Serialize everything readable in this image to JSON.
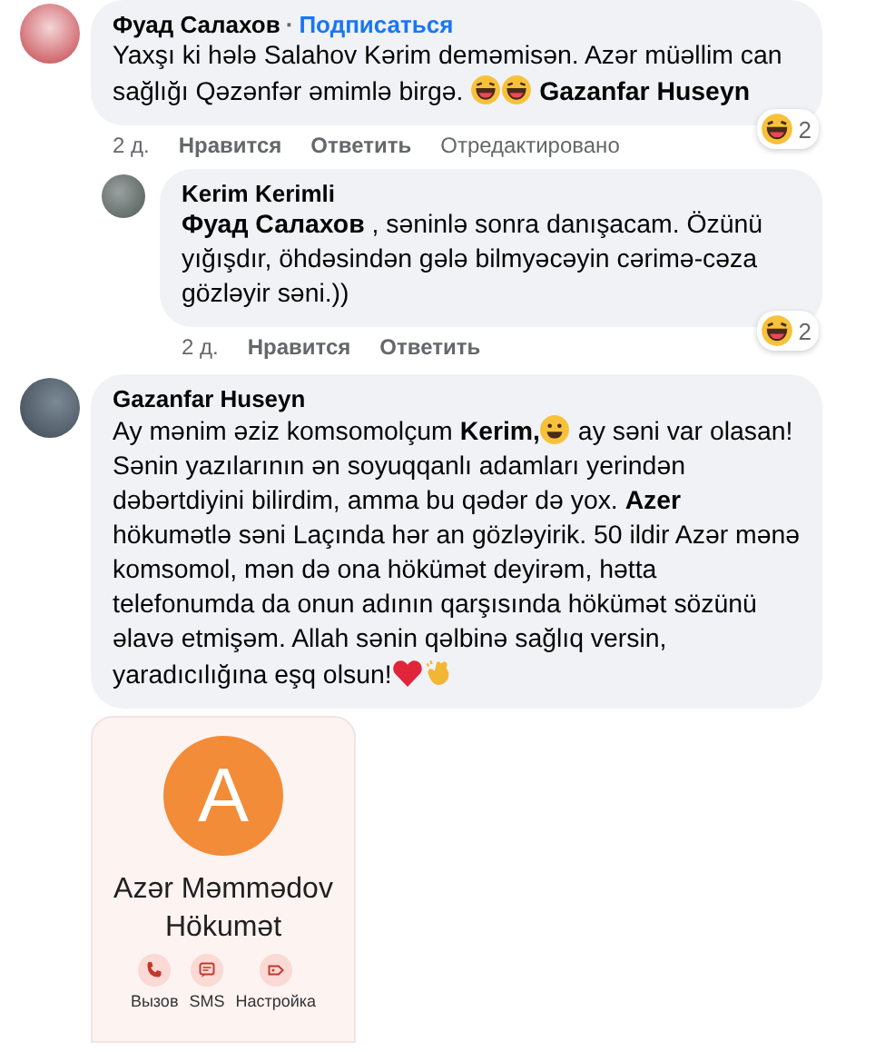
{
  "comments": [
    {
      "author": "Фуад Салахов",
      "separator": "·",
      "follow": "Подписаться",
      "body": [
        {
          "kind": "text",
          "text": "Yaxşı ki hələ Salahov Kərim deməmisən. Azər müəllim can sağlığı Qəzənfər əmimlə birgə. "
        },
        {
          "kind": "laugh"
        },
        {
          "kind": "laugh"
        },
        {
          "kind": "text",
          "text": " **Gazanfar Huseyn**"
        }
      ],
      "time": "2 д.",
      "like": "Нравится",
      "reply": "Ответить",
      "edited": "Отредактировано",
      "reaction_count": "2",
      "children": [
        {
          "author": "Kerim Kerimli",
          "body": [
            {
              "kind": "text",
              "text": "**Фуад Салахов** , səninlə sonra danışacam. Özünü yığışdır, öhdəsindən gələ bilmyəcəyin cərimə-cəza gözləyir səni.))"
            }
          ],
          "time": "2 д.",
          "like": "Нравится",
          "reply": "Ответить",
          "reaction_count": "2"
        }
      ]
    },
    {
      "author": "Gazanfar Huseyn",
      "body": [
        {
          "kind": "text",
          "text": "Ay mənim əziz komsomolçum **Kerim,**"
        },
        {
          "kind": "smile"
        },
        {
          "kind": "text",
          "text": " ay səni var olasan! Sənin yazılarının ən soyuqqanlı adamları yerindən dəbərtdiyini bilirdim, amma bu qədər də yox. **Azer** hökumətlə səni Laçında hər an gözləyirik. 50 ildir Azər mənə komsomol, mən də ona hökümət deyirəm, hətta telefonumda da onun adının qarşısında hökümət sözünü əlavə etmişəm. Allah sənin qəlbinə sağlıq versin, yaradıcılığına eşq olsun!"
        },
        {
          "kind": "heart"
        },
        {
          "kind": "clap"
        }
      ],
      "attachment": {
        "letter": "A",
        "name": "Azər Məmmədov Hökumət",
        "actions": [
          {
            "kind": "call",
            "label": "Вызов"
          },
          {
            "kind": "sms",
            "label": "SMS"
          },
          {
            "kind": "settings",
            "label": "Настройка"
          }
        ]
      }
    }
  ]
}
